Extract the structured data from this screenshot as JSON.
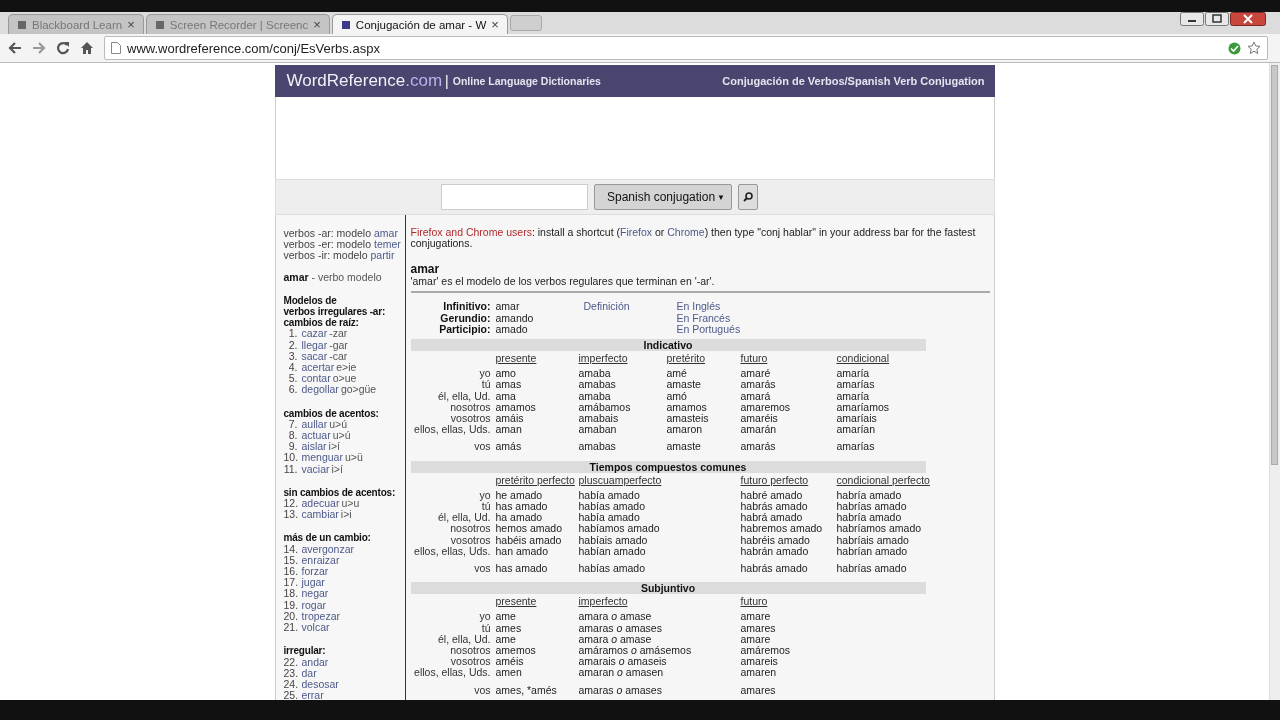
{
  "browser": {
    "tabs": [
      {
        "title": "Blackboard Learn",
        "selected": false
      },
      {
        "title": "Screen Recorder | Screenc",
        "selected": false
      },
      {
        "title": "Conjugación de amar - W",
        "selected": true
      }
    ],
    "close_glyph": "×",
    "url": "www.wordreference.com/conj/EsVerbs.aspx"
  },
  "header": {
    "logo": "WordReference",
    "logo_domain": ".com",
    "separator": "|",
    "tagline": "Online Language Dictionaries",
    "title": "Conjugación de Verbos/Spanish Verb Conjugation"
  },
  "search": {
    "language": "Spanish conjugation",
    "dropdown_arrow": "▼"
  },
  "sidebar": {
    "models": [
      {
        "label": "verbos -ar: modelo",
        "verb": "amar"
      },
      {
        "label": "verbos -er: modelo",
        "verb": "temer"
      },
      {
        "label": "verbos -ir: modelo",
        "verb": "partir"
      }
    ],
    "current": "**amar** - verbo modelo",
    "groups": [
      {
        "heading": [
          "Modelos de",
          "verbos irregulares -ar:",
          "cambios de raíz:"
        ],
        "items": [
          {
            "number": "1.",
            "verb": "cazar",
            "change": "-zar"
          },
          {
            "number": "2.",
            "verb": "llegar",
            "change": "-gar"
          },
          {
            "number": "3.",
            "verb": "sacar",
            "change": "-car"
          },
          {
            "number": "4.",
            "verb": "acertar",
            "change": "e>ie"
          },
          {
            "number": "5.",
            "verb": "contar",
            "change": "o>ue"
          },
          {
            "number": "6.",
            "verb": "degollar",
            "change": "go>güe"
          }
        ]
      },
      {
        "heading": [
          "cambios de acentos:"
        ],
        "items": [
          {
            "number": "7.",
            "verb": "aullar",
            "change": "u>ú"
          },
          {
            "number": "8.",
            "verb": "actuar",
            "change": "u>ú"
          },
          {
            "number": "9.",
            "verb": "aislar",
            "change": "i>í"
          },
          {
            "number": "10.",
            "verb": "menguar",
            "change": "u>ü"
          },
          {
            "number": "11.",
            "verb": "vaciar",
            "change": "i>í"
          }
        ]
      },
      {
        "heading": [
          "sin cambios de acentos:"
        ],
        "items": [
          {
            "number": "12.",
            "verb": "adecuar",
            "change": "u>u"
          },
          {
            "number": "13.",
            "verb": "cambiar",
            "change": "i>i"
          }
        ]
      },
      {
        "heading": [
          "más de un cambio:"
        ],
        "items": [
          {
            "number": "14.",
            "verb": "avergonzar"
          },
          {
            "number": "15.",
            "verb": "enraizar"
          },
          {
            "number": "16.",
            "verb": "forzar"
          },
          {
            "number": "17.",
            "verb": "jugar"
          },
          {
            "number": "18.",
            "verb": "negar"
          },
          {
            "number": "19.",
            "verb": "rogar"
          },
          {
            "number": "20.",
            "verb": "tropezar"
          },
          {
            "number": "21.",
            "verb": "volcar"
          }
        ]
      },
      {
        "heading": [
          "irregular:"
        ],
        "items": [
          {
            "number": "22.",
            "verb": "andar"
          },
          {
            "number": "23.",
            "verb": "dar"
          },
          {
            "number": "24.",
            "verb": "desosar"
          },
          {
            "number": "25.",
            "verb": "errar"
          }
        ]
      }
    ]
  },
  "notice": [
    {
      "text": "Firefox and Chrome users",
      "kind": "lead"
    },
    {
      "text": ": install a shortcut (",
      "kind": "plain"
    },
    {
      "text": "Firefox",
      "kind": "link"
    },
    {
      "text": " or ",
      "kind": "plain"
    },
    {
      "text": "Chrome",
      "kind": "link"
    },
    {
      "text": ") then type \"conj hablar\" in your address bar for the fastest conjugations.",
      "kind": "plain"
    }
  ],
  "verb": "amar",
  "description": "'amar' es el modelo de los verbos regulares que terminan en '-ar'.",
  "forms": [
    {
      "label": "Infinitivo:",
      "value": "amar"
    },
    {
      "label": "Gerundio:",
      "value": "amando"
    },
    {
      "label": "Participio:",
      "value": "amado"
    }
  ],
  "definition_link": "Definición",
  "translation_links": [
    "En Inglés",
    "En Francés",
    "En Portugués"
  ],
  "sections": [
    {
      "title": "Indicativo",
      "columns": [
        {
          "label": "presente",
          "kind": "tense"
        },
        {
          "label": "imperfecto",
          "kind": "tense"
        },
        {
          "label": "pretérito",
          "kind": "tense"
        },
        {
          "label": "futuro",
          "kind": "tense"
        },
        {
          "label": "condicional",
          "kind": "tense"
        }
      ],
      "rows": [
        {
          "pronoun": "yo",
          "forms": [
            "amo",
            "amaba",
            "amé",
            "amaré",
            "amaría"
          ]
        },
        {
          "pronoun": "tú",
          "forms": [
            "amas",
            "amabas",
            "amaste",
            "amarás",
            "amarías"
          ]
        },
        {
          "pronoun": "él, ella, Ud.",
          "forms": [
            "ama",
            "amaba",
            "amó",
            "amará",
            "amaría"
          ]
        },
        {
          "pronoun": "nosotros",
          "forms": [
            "amamos",
            "amábamos",
            "amamos",
            "amaremos",
            "amaríamos"
          ]
        },
        {
          "pronoun": "vosotros",
          "forms": [
            "amáis",
            "amabais",
            "amasteis",
            "amaréis",
            "amaríais"
          ]
        },
        {
          "pronoun": "ellos, ellas, Uds.",
          "forms": [
            "aman",
            "amaban",
            "amaron",
            "amarán",
            "amarían"
          ]
        }
      ],
      "vos": {
        "pronoun": "vos",
        "forms": [
          "amás",
          "amabas",
          "amaste",
          "amarás",
          "amarías"
        ]
      }
    },
    {
      "title": "Tiempos compuestos comunes",
      "columns": [
        {
          "label": "pretérito perfecto",
          "kind": "tense"
        },
        {
          "label": "pluscuamperfecto",
          "kind": "wide"
        },
        {
          "label": "futuro perfecto",
          "kind": "tense"
        },
        {
          "label": "condicional perfecto",
          "kind": "tense"
        }
      ],
      "rows": [
        {
          "pronoun": "yo",
          "forms": [
            "he amado",
            "había amado",
            "habré amado",
            "habría amado"
          ]
        },
        {
          "pronoun": "tú",
          "forms": [
            "has amado",
            "habías amado",
            "habrás amado",
            "habrías amado"
          ]
        },
        {
          "pronoun": "él, ella, Ud.",
          "forms": [
            "ha amado",
            "había amado",
            "habrá amado",
            "habría amado"
          ]
        },
        {
          "pronoun": "nosotros",
          "forms": [
            "hemos amado",
            "habíamos amado",
            "habremos amado",
            "habríamos amado"
          ]
        },
        {
          "pronoun": "vosotros",
          "forms": [
            "habéis amado",
            "habíais amado",
            "habréis amado",
            "habríais amado"
          ]
        },
        {
          "pronoun": "ellos, ellas, Uds.",
          "forms": [
            "han amado",
            "habían amado",
            "habrán amado",
            "habrían amado"
          ]
        }
      ],
      "vos": {
        "pronoun": "vos",
        "forms": [
          "has amado",
          "habías amado",
          "habrás amado",
          "habrías amado"
        ]
      }
    },
    {
      "title": "Subjuntivo",
      "columns": [
        {
          "label": "presente",
          "kind": "tense"
        },
        {
          "label": "imperfecto",
          "kind": "wide"
        },
        {
          "label": "futuro",
          "kind": "tense"
        }
      ],
      "rows": [
        {
          "pronoun": "yo",
          "forms": [
            "ame",
            "amara *o* amase",
            "amare"
          ]
        },
        {
          "pronoun": "tú",
          "forms": [
            "ames",
            "amaras *o* amases",
            "amares"
          ]
        },
        {
          "pronoun": "él, ella, Ud.",
          "forms": [
            "ame",
            "amara *o* amase",
            "amare"
          ]
        },
        {
          "pronoun": "nosotros",
          "forms": [
            "amemos",
            "amáramos *o* amásemos",
            "amáremos"
          ]
        },
        {
          "pronoun": "vosotros",
          "forms": [
            "améis",
            "amarais *o* amaseis",
            "amareis"
          ]
        },
        {
          "pronoun": "ellos, ellas, Uds.",
          "forms": [
            "amen",
            "amaran *o* amasen",
            "amaren"
          ]
        }
      ],
      "vos": {
        "pronoun": "vos",
        "forms": [
          "ames, *amés",
          "amaras *o* amases",
          "amares"
        ]
      }
    }
  ]
}
